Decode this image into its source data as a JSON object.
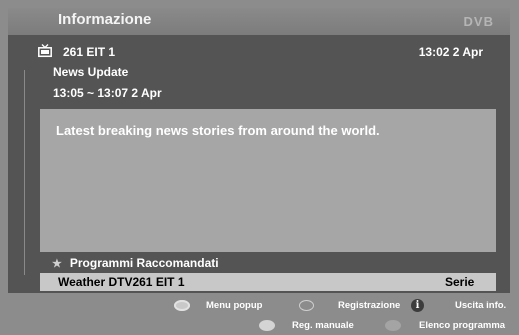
{
  "header": {
    "title": "Informazione",
    "logo": "DVB"
  },
  "channel": {
    "icon": "tv-icon",
    "label": "261 EIT 1",
    "current_time": "13:02 2 Apr"
  },
  "program": {
    "title": "News Update",
    "time_range": "13:05 ~ 13:07 2 Apr",
    "description": "Latest breaking news stories from around the world."
  },
  "recommended": {
    "heading": "Programmi Raccomandati",
    "items": [
      {
        "name": "Weather DTV261 EIT 1",
        "type": "Serie"
      }
    ]
  },
  "footer": {
    "red": "Menu popup",
    "green": "Registrazione",
    "info": "Uscita info.",
    "yellow": "Reg. manuale",
    "blue": "Elenco programma"
  },
  "colors": {
    "background": "#8c8c8c",
    "panel": "#545454",
    "description_box": "#a6a6a6",
    "highlight_row": "#c8c8c8"
  }
}
